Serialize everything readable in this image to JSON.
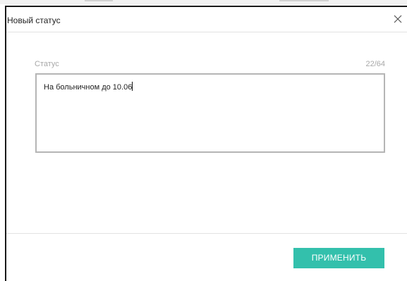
{
  "dialog": {
    "title": "Новый статус",
    "close_icon": "close-icon"
  },
  "status_field": {
    "label": "Статус",
    "counter": "22/64",
    "value": "На больничном до 10.06"
  },
  "footer": {
    "apply_label": "ПРИМЕНИТЬ"
  },
  "colors": {
    "accent": "#33c0ac",
    "border": "#b5b5b5",
    "muted_text": "#a8a8a8"
  }
}
